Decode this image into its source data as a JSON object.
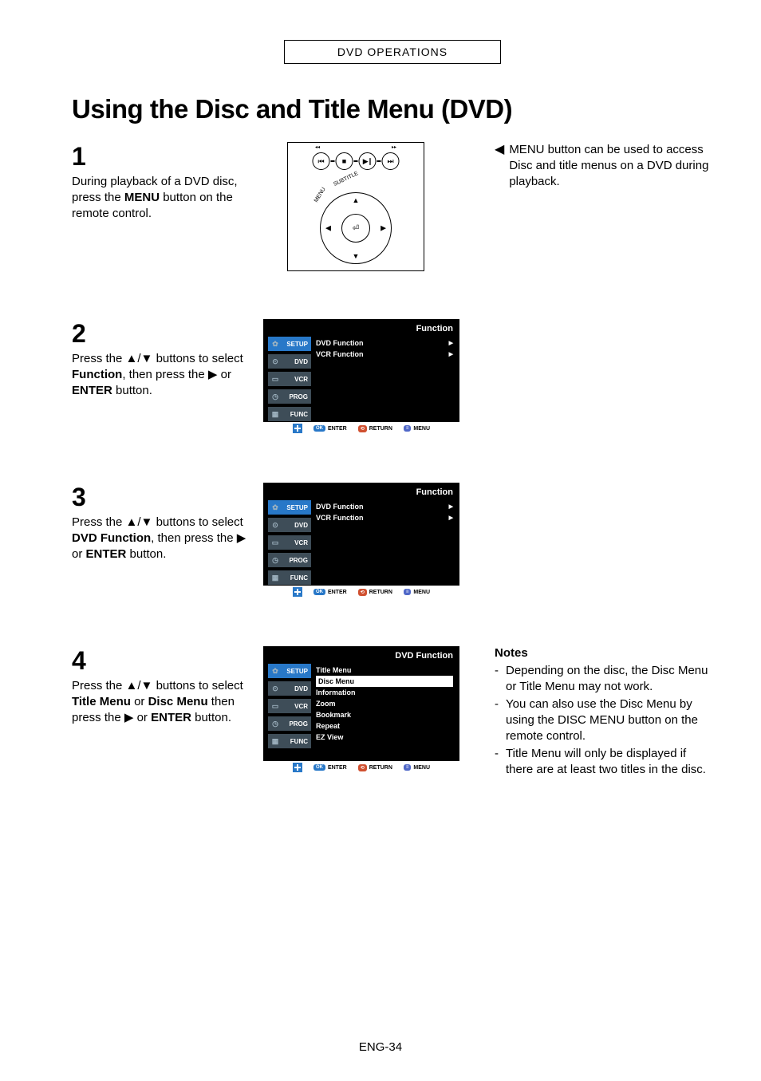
{
  "header": "DVD OPERATIONS",
  "page_title": "Using the Disc and Title Menu (DVD)",
  "steps": {
    "s1": {
      "num": "1",
      "pre": "During playback of a DVD disc, press the ",
      "bold": "MENU",
      "post": " button on the remote control."
    },
    "s2": {
      "num": "2",
      "text_a": "Press the ",
      "text_b": "▲/▼",
      "text_c": " buttons to select ",
      "bold1": "Function",
      "text_d": ", then press the ",
      "tri": "▶",
      "text_e": " or ",
      "bold2": "ENTER",
      "text_f": " button."
    },
    "s3": {
      "num": "3",
      "text_a": "Press the ",
      "text_b": "▲/▼",
      "text_c": " buttons to select ",
      "bold1": "DVD Function",
      "text_d": ", then press the ",
      "tri": "▶",
      "text_e": " or ",
      "bold2": "ENTER",
      "text_f": " button."
    },
    "s4": {
      "num": "4",
      "text_a": "Press the ",
      "text_b": "▲/▼",
      "text_c": " buttons to select ",
      "bold1": "Title Menu",
      "text_d": " or ",
      "bold2": "Disc Menu",
      "text_e": " then press the ",
      "tri": "▶",
      "text_f": " or ",
      "bold3": "ENTER",
      "text_g": " button."
    }
  },
  "tip": {
    "arrow": "◀",
    "text": "MENU button can be used to access Disc and title menus on a DVD during playback."
  },
  "osd": {
    "sidebar": {
      "setup": "SETUP",
      "dvd": "DVD",
      "vcr": "VCR",
      "prog": "PROG",
      "func": "FUNC"
    },
    "title_function": "Function",
    "title_dvdfunction": "DVD Function",
    "rows_func": {
      "dvd": "DVD Function",
      "vcr": "VCR Function"
    },
    "rows_dvdfunc": {
      "title": "Title Menu",
      "disc": "Disc Menu",
      "info": "Information",
      "zoom": "Zoom",
      "bookmark": "Bookmark",
      "repeat": "Repeat",
      "ez": "EZ View"
    },
    "footer": {
      "enter": "ENTER",
      "return": "RETURN",
      "menu": "MENU",
      "pill_enter": "OK",
      "pill_return": "⟲",
      "pill_menu": "≡"
    }
  },
  "remote": {
    "skip_back": "⏮",
    "stop": "■",
    "play_pause": "▶∥",
    "skip_fwd": "⏭",
    "subtitle": "SUBTITLE",
    "menu": "MENU",
    "enter": "⏎",
    "up": "▲",
    "down": "▼",
    "left": "◀",
    "right": "▶"
  },
  "notes": {
    "heading": "Notes",
    "n1": "Depending on the disc, the Disc Menu or Title Menu may not work.",
    "n2": "You can also use the Disc Menu by using the DISC MENU button on the remote control.",
    "n3": "Title Menu will only be displayed if there are at least two titles in the disc."
  },
  "page_number": "ENG-34"
}
